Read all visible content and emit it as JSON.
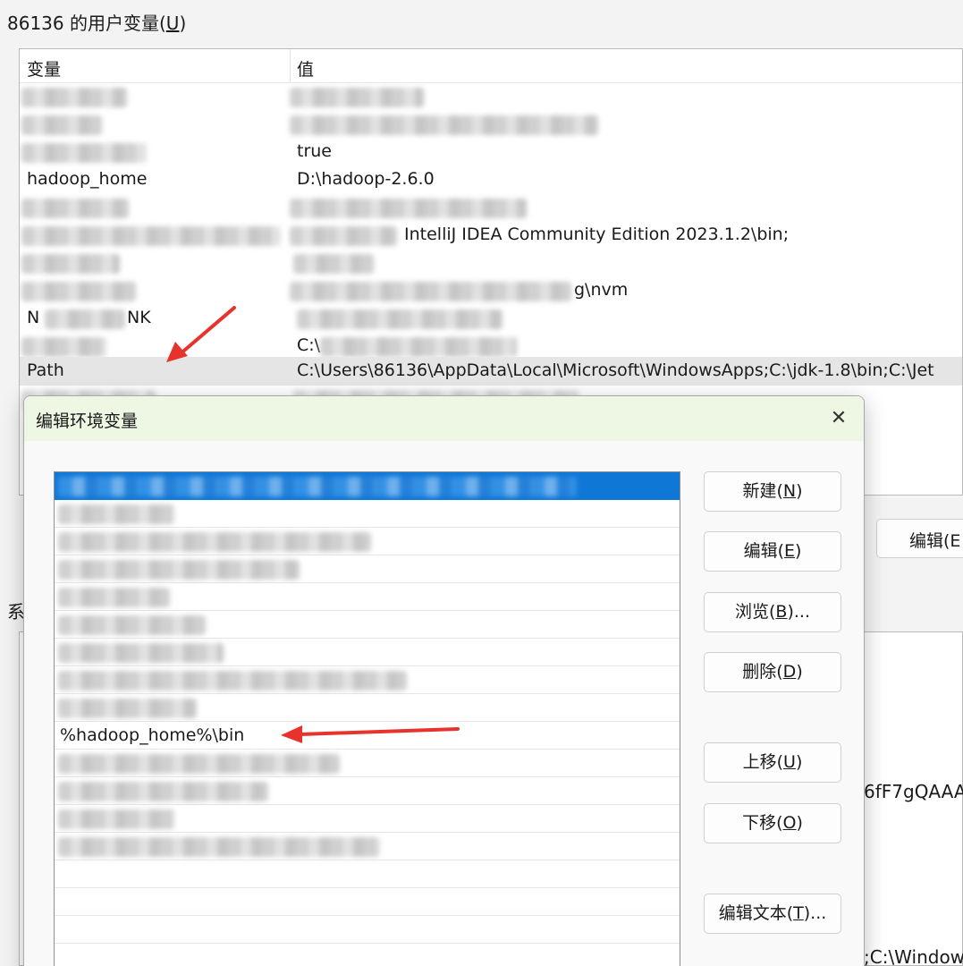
{
  "window": {
    "user_vars_title": "86136 的用户变量(",
    "user_vars_title_key": "U",
    "user_vars_title_end": ")"
  },
  "user_vars": {
    "headers": {
      "name": "变量",
      "value": "值"
    },
    "rows": [
      {
        "name": "hadoop_home",
        "value": "D:\\hadoop-2.6.0"
      },
      {
        "name": "Path",
        "value": "C:\\Users\\86136\\AppData\\Local\\Microsoft\\WindowsApps;C:\\jdk-1.8\\bin;C:\\Jet"
      }
    ],
    "partial_values": {
      "ides_bin": "IntelliJ IDEA Community Edition 2023.1.2\\bin;",
      "nvm_tail": "g\\nvm",
      "nk_name": "N",
      "nk_name_tail": "NK",
      "onedrive_value": "C:\\",
      "true_value": "true"
    }
  },
  "background": {
    "edit_button": "编辑(E",
    "sys_label": "系",
    "frag_1": "6fF7gQAAA",
    "frag_2": ";C:\\Window"
  },
  "dialog": {
    "title": "编辑环境变量",
    "close_glyph": "✕",
    "path_entries": [
      {
        "text": "",
        "selected": true
      },
      {
        "text": ""
      },
      {
        "text": ""
      },
      {
        "text": ""
      },
      {
        "text": ""
      },
      {
        "text": ""
      },
      {
        "text": ""
      },
      {
        "text": ""
      },
      {
        "text": ""
      },
      {
        "text": "%hadoop_home%\\bin"
      },
      {
        "text": ""
      },
      {
        "text": ""
      },
      {
        "text": ""
      },
      {
        "text": ""
      },
      {
        "text": ""
      },
      {
        "text": ""
      },
      {
        "text": ""
      }
    ],
    "buttons": {
      "new": {
        "label": "新建(",
        "key": "N",
        "end": ")"
      },
      "edit": {
        "label": "编辑(",
        "key": "E",
        "end": ")"
      },
      "browse": {
        "label": "浏览(",
        "key": "B",
        "end": ")..."
      },
      "delete": {
        "label": "删除(",
        "key": "D",
        "end": ")"
      },
      "move_up": {
        "label": "上移(",
        "key": "U",
        "end": ")"
      },
      "move_down": {
        "label": "下移(",
        "key": "O",
        "end": ")"
      },
      "edit_text": {
        "label": "编辑文本(",
        "key": "T",
        "end": ")..."
      }
    }
  },
  "colors": {
    "selection": "#0f78d7",
    "arrow": "#e8322c",
    "dialog_titlebar": "#eef7e4"
  },
  "annotations": {
    "arrows": [
      "arrow-to-path-row",
      "arrow-to-hadoop-bin-entry"
    ]
  }
}
